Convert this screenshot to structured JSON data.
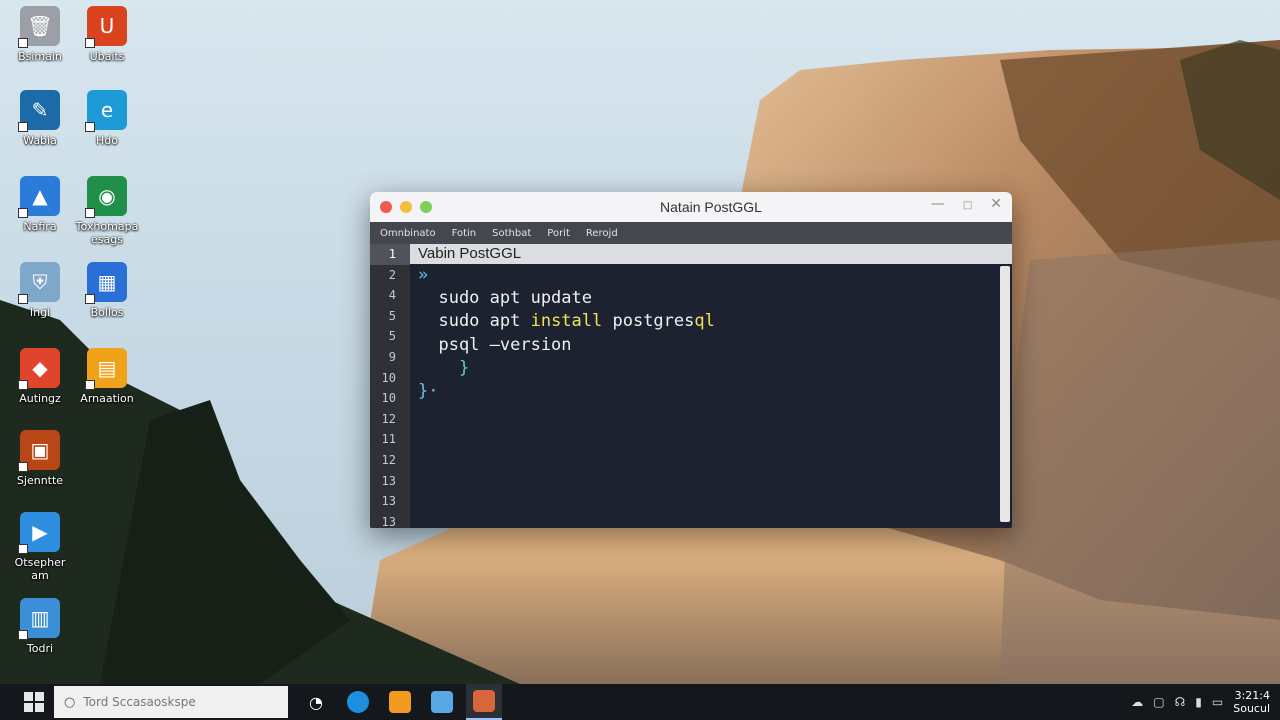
{
  "desktop": {
    "icons": [
      {
        "label": "Bsimain",
        "color": "#9aa0a6",
        "glyph": "🗑"
      },
      {
        "label": "Ubaits",
        "color": "#d9431e",
        "glyph": "U"
      },
      {
        "label": "Wabia",
        "color": "#1c6aa8",
        "glyph": "✎"
      },
      {
        "label": "Hdo",
        "color": "#1d9bd6",
        "glyph": "e"
      },
      {
        "label": "Nafira",
        "color": "#2b7bd9",
        "glyph": "▲"
      },
      {
        "label": "Toxhomapa\nesags",
        "color": "#1f8f4a",
        "glyph": "◉"
      },
      {
        "label": "Ingi",
        "color": "#7fa7c9",
        "glyph": "⛨"
      },
      {
        "label": "Bollos",
        "color": "#2a6fd6",
        "glyph": "▦"
      },
      {
        "label": "Autingz",
        "color": "#e0442d",
        "glyph": "◆"
      },
      {
        "label": "Arnaation",
        "color": "#f1a21b",
        "glyph": "▤"
      },
      {
        "label": "Sjenntte",
        "color": "#b84616",
        "glyph": "▣"
      },
      {
        "label": "Otsepher\nam",
        "color": "#2e8fe0",
        "glyph": "▶"
      },
      {
        "label": "Todri",
        "color": "#3b8fd6",
        "glyph": "▥"
      }
    ]
  },
  "window": {
    "title": "Natain PostGGL",
    "menu": [
      "Omnbinato",
      "Fotin",
      "Sothbat",
      "Porit",
      "Rerojd"
    ],
    "active_line": "Vabin PostGGL",
    "gutter": [
      "1",
      "2",
      "4",
      "5",
      "5",
      "9",
      "10",
      "10",
      "12",
      "11",
      "12",
      "13",
      "13",
      "13"
    ],
    "code_lines": [
      {
        "text": "»",
        "kind": "brace"
      },
      {
        "text": "  sudo apt update",
        "kind": "plain"
      },
      {
        "text": "  sudo apt install postgresql",
        "kind": "mixed",
        "pre": "  sudo apt ",
        "hl": "install",
        "mid": " postgres",
        "hl2": "ql"
      },
      {
        "text": "  psql —version",
        "kind": "plain"
      },
      {
        "text": "    }",
        "kind": "brace"
      },
      {
        "text": "}·",
        "kind": "brace"
      }
    ]
  },
  "taskbar": {
    "search_placeholder": "Tord Sccasaoskspe",
    "clock_time": "3:21:4",
    "clock_date": "Soucul"
  },
  "colors": {
    "close": "#ef5a4f",
    "minimize": "#f4bd3f",
    "maximize": "#7ccf58"
  }
}
